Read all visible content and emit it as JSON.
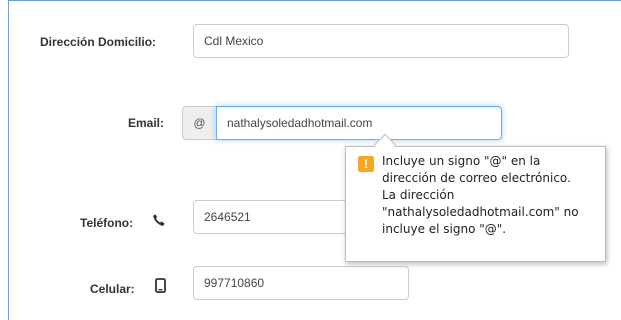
{
  "form": {
    "address": {
      "label": "Dirección Domicilio:",
      "value": "Cdl Mexico"
    },
    "email": {
      "label": "Email:",
      "addon": "@",
      "value": "nathalysoledadhotmail.com"
    },
    "phone": {
      "label": "Teléfono:",
      "icon": "phone-icon",
      "value": "2646521"
    },
    "mobile": {
      "label": "Celular:",
      "icon": "mobile-phone-icon",
      "value": "997710860"
    }
  },
  "validation_tooltip": {
    "icon": "warning-icon",
    "icon_glyph": "!",
    "lines": [
      "Incluye un signo \"@\" en la",
      "dirección de correo electrónico.",
      "La dirección",
      "\"nathalysoledadhotmail.com\" no",
      "incluye el signo \"@\"."
    ]
  },
  "colors": {
    "focus_border": "#66afe9",
    "warning": "#f5a623",
    "panel_border": "#6d9fd3"
  }
}
